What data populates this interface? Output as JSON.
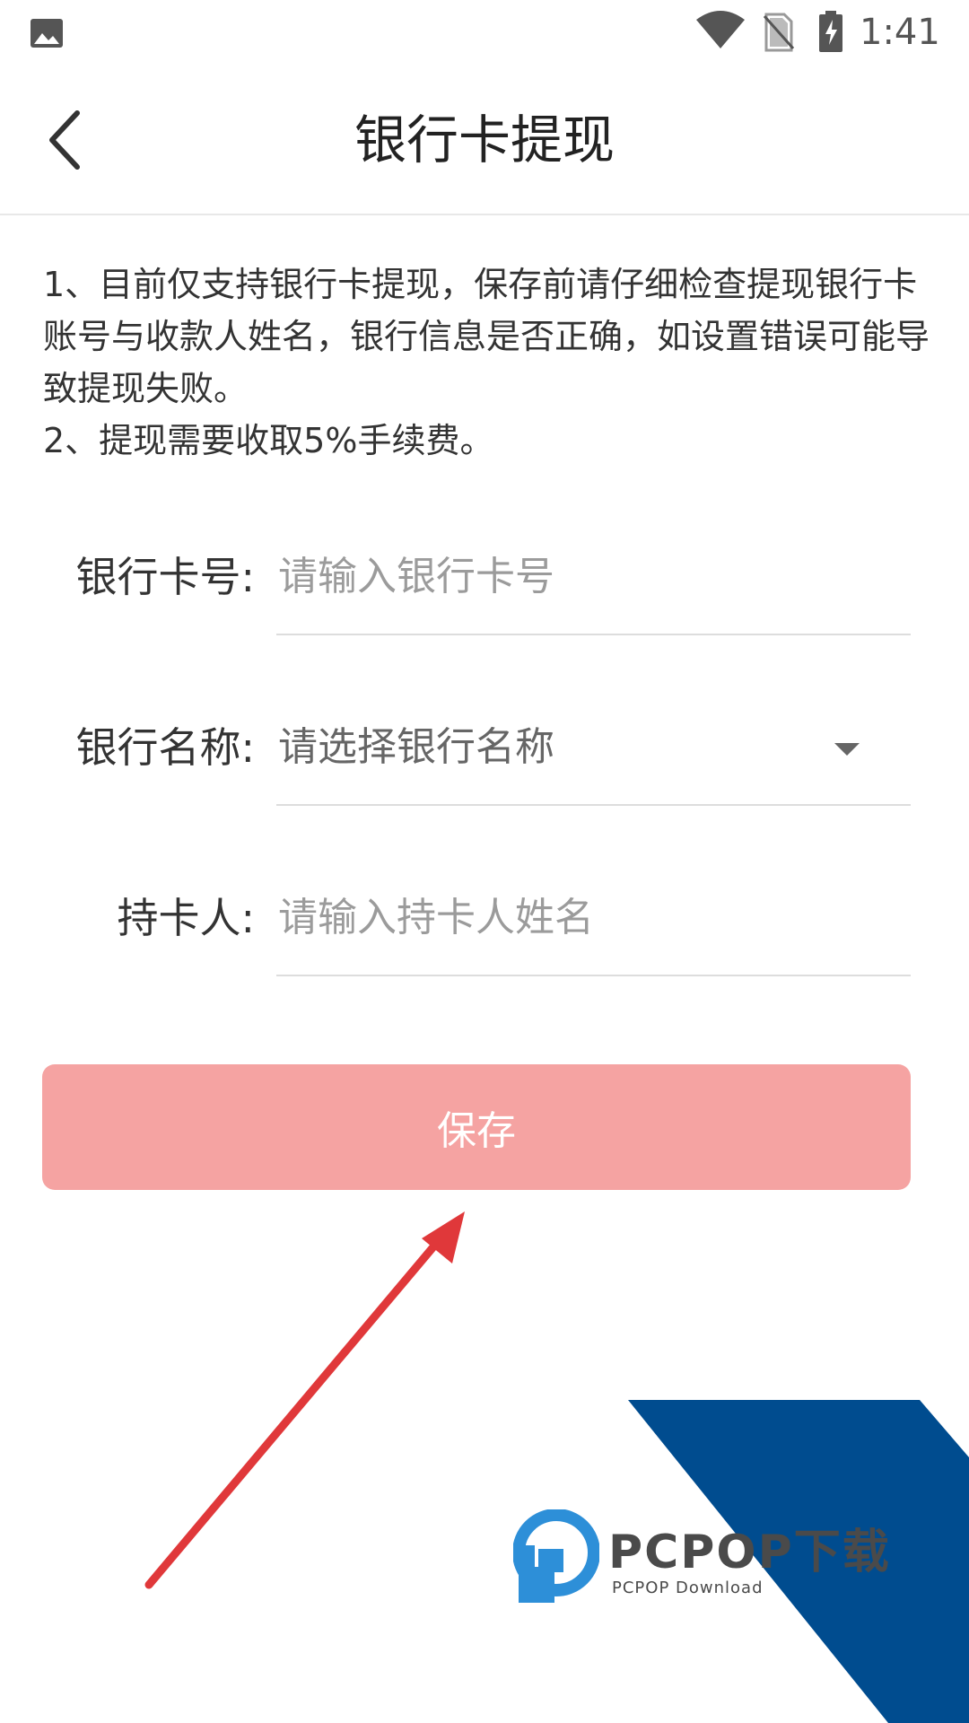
{
  "status_bar": {
    "time": "1:41",
    "icons": [
      "gallery-icon",
      "wifi-icon",
      "no-sim-icon",
      "battery-charging-icon"
    ]
  },
  "header": {
    "title": "银行卡提现",
    "back_icon": "chevron-left-icon"
  },
  "notes": [
    "1、目前仅支持银行卡提现，保存前请仔细检查提现银行卡账号与收款人姓名，银行信息是否正确，如设置错误可能导致提现失败。",
    "2、提现需要收取5%手续费。"
  ],
  "form": {
    "card_number": {
      "label": "银行卡号:",
      "placeholder": "请输入银行卡号",
      "value": ""
    },
    "bank_name": {
      "label": "银行名称:",
      "selected": "请选择银行名称",
      "icon": "dropdown-arrow-icon"
    },
    "cardholder": {
      "label": "持卡人:",
      "placeholder": "请输入持卡人姓名",
      "value": ""
    }
  },
  "save_button": {
    "label": "保存",
    "color": "#f5a3a2"
  },
  "annotation": {
    "arrow_color": "#e0383a"
  },
  "watermark": {
    "brand": "PCPOP下载",
    "subtitle": "PCPOP Download",
    "band_color": "#004c8f",
    "logo_color": "#2d8fd8"
  }
}
